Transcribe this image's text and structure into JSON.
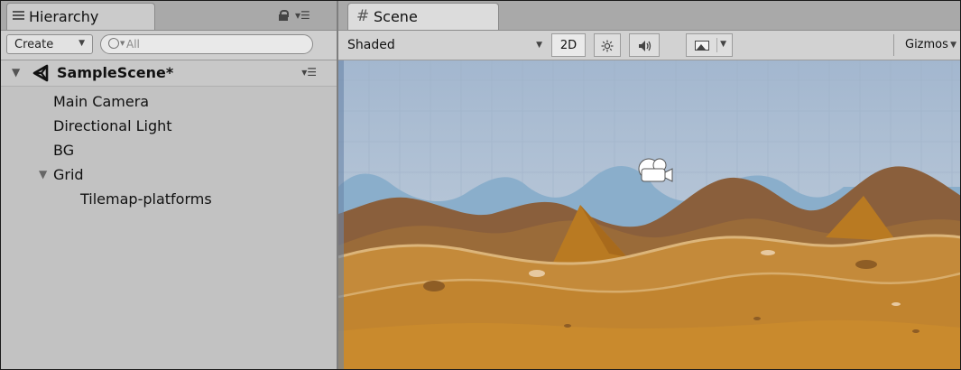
{
  "hierarchy": {
    "tab_label": "Hierarchy",
    "create_label": "Create",
    "search_placeholder": "All",
    "scene_name": "SampleScene*",
    "items": [
      {
        "label": "Main Camera"
      },
      {
        "label": "Directional Light"
      },
      {
        "label": "BG"
      },
      {
        "label": "Grid"
      },
      {
        "label": "Tilemap-platforms"
      }
    ]
  },
  "scene": {
    "tab_label": "Scene",
    "shading_mode": "Shaded",
    "mode_2d_label": "2D",
    "gizmos_label": "Gizmos"
  },
  "icons": {
    "hierarchy": "list-icon",
    "lock": "lock-icon",
    "scene": "hash-icon",
    "unity": "unity-logo-icon",
    "light": "sun-icon",
    "audio": "speaker-icon",
    "effects": "image-icon",
    "camera": "camera-icon"
  },
  "colors": {
    "sky": "#a7bed6",
    "dunes": "#c18431",
    "far_hills": "#8eb2cc"
  }
}
